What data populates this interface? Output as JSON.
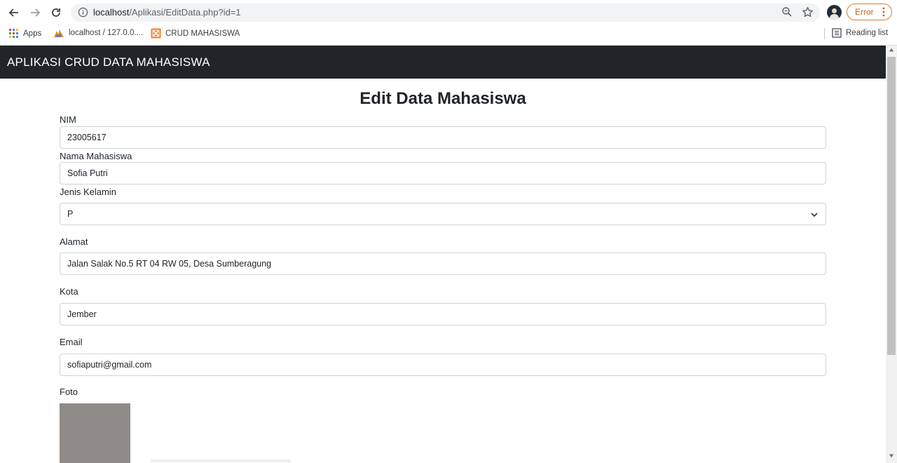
{
  "browser": {
    "url_host": "localhost",
    "url_path": "/Aplikasi/EditData.php?id=1",
    "error_label": "Error",
    "bookmarks": [
      {
        "label": "Apps",
        "icon": "apps-grid-icon"
      },
      {
        "label": "localhost / 127.0.0....",
        "icon": "phpmyadmin-icon"
      },
      {
        "label": "CRUD MAHASISWA",
        "icon": "xampp-icon"
      }
    ],
    "reading_list": "Reading list"
  },
  "app": {
    "title": "APLIKASI CRUD DATA MAHASISWA"
  },
  "form": {
    "heading": "Edit Data Mahasiswa",
    "nim": {
      "label": "NIM",
      "value": "23005617"
    },
    "nama": {
      "label": "Nama Mahasiswa",
      "value": "Sofia Putri"
    },
    "jenis_kelamin": {
      "label": "Jenis Kelamin",
      "value": "P"
    },
    "alamat": {
      "label": "Alamat",
      "value": "Jalan Salak No.5 RT 04 RW 05, Desa Sumberagung"
    },
    "kota": {
      "label": "Kota",
      "value": "Jember"
    },
    "email": {
      "label": "Email",
      "value": "sofiaputri@gmail.com"
    },
    "foto": {
      "label": "Foto"
    }
  },
  "colors": {
    "appbar": "#212529",
    "error_accent": "#e07b2d"
  }
}
